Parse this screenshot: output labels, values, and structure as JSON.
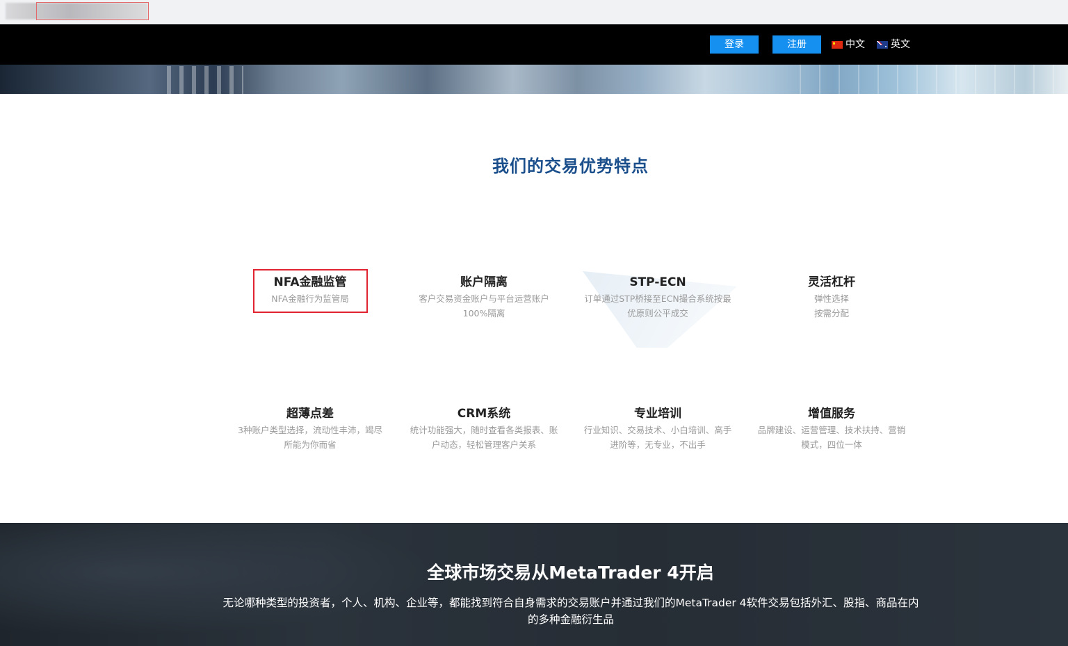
{
  "header": {
    "login_label": "登录",
    "register_label": "注册",
    "lang_cn": "中文",
    "lang_en": "英文"
  },
  "features": {
    "title": "我们的交易优势特点",
    "items": [
      {
        "title": "NFA金融监管",
        "desc": "NFA金融行为监管局"
      },
      {
        "title": "账户隔离",
        "desc": "客户交易资金账户与平台运营账户100%隔离"
      },
      {
        "title": "STP-ECN",
        "desc": "订单通过STP桥接至ECN撮合系统按最优原则公平成交"
      },
      {
        "title": "灵活杠杆",
        "desc_lines": [
          "弹性选择",
          "按需分配"
        ]
      },
      {
        "title": "超薄点差",
        "desc": "3种账户类型选择，流动性丰沛，竭尽所能为你而省"
      },
      {
        "title": "CRM系统",
        "desc": "统计功能强大，随时查看各类报表、账户动态，轻松管理客户关系"
      },
      {
        "title": "专业培训",
        "desc": "行业知识、交易技术、小白培训、高手进阶等，无专业，不出手"
      },
      {
        "title": "增值服务",
        "desc": "品牌建设、运营管理、技术扶持、营销模式，四位一体"
      }
    ]
  },
  "promo": {
    "title": "全球市场交易从MetaTrader 4开启",
    "desc": "无论哪种类型的投资者，个人、机构、企业等，都能找到符合自身需求的交易账户并通过我们的MetaTrader 4软件交易包括外汇、股指、商品在内的多种金融衍生品"
  },
  "colors": {
    "accent_button": "#1590f0",
    "title_blue": "#1a4f8c",
    "highlight_red": "#e0232e"
  }
}
